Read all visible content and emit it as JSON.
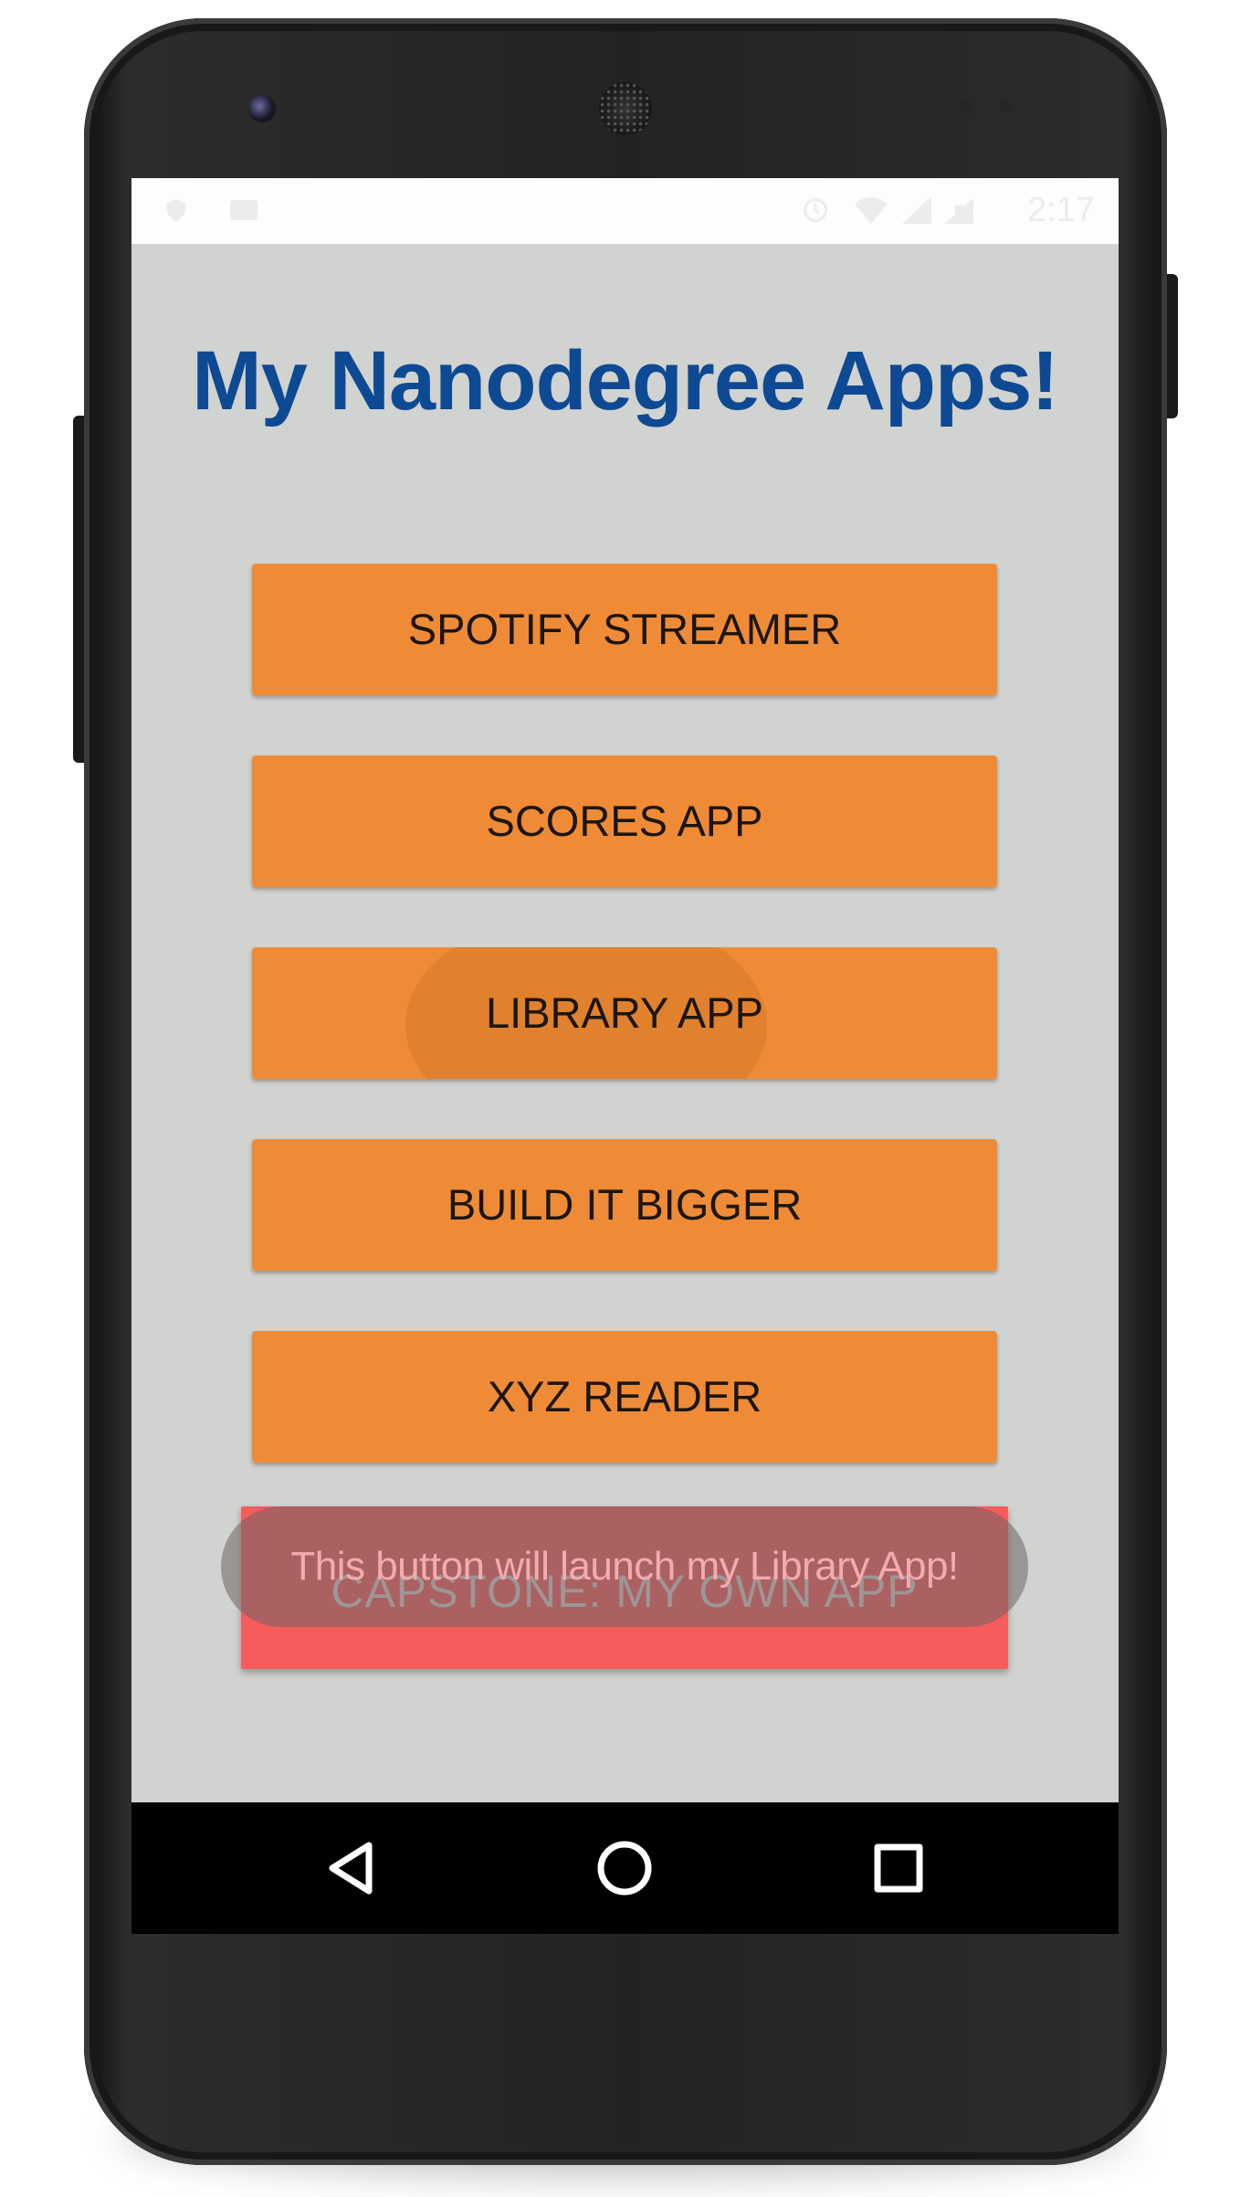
{
  "status_bar": {
    "time": "2:17",
    "icons": [
      "notification-icon",
      "image-icon",
      "alarm-icon",
      "wifi-icon",
      "signal-icon",
      "battery-icon"
    ]
  },
  "app": {
    "title": "My Nanodegree Apps!",
    "buttons": [
      {
        "label": "SPOTIFY STREAMER"
      },
      {
        "label": "SCORES APP"
      },
      {
        "label": "LIBRARY APP",
        "state": "pressed"
      },
      {
        "label": "BUILD IT BIGGER"
      },
      {
        "label": "XYZ READER"
      }
    ],
    "capstone_button": {
      "label": "CAPSTONE: MY OWN APP"
    },
    "toast": "This button will launch my Library App!"
  },
  "nav_bar": {
    "buttons": [
      "back-icon",
      "home-icon",
      "recents-icon"
    ]
  },
  "colors": {
    "screen_background": "#d1d3d0",
    "title": "#0e4a93",
    "button": "#ef8b36",
    "capstone_button": "#f75c5d",
    "toast": "#6e6464"
  }
}
